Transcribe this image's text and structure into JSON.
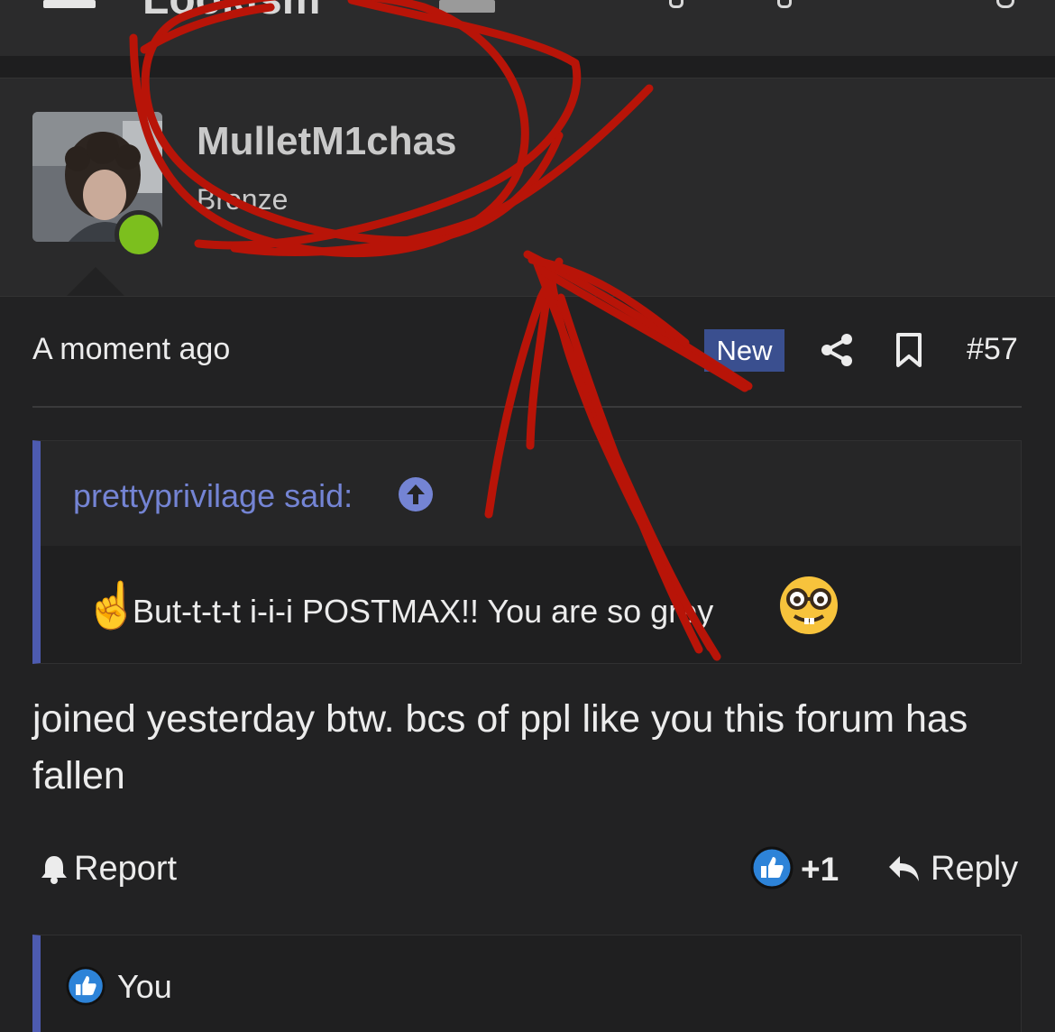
{
  "header": {
    "brand_partial": "Lookism",
    "menu_icon": "hamburger-icon"
  },
  "post": {
    "author": {
      "username": "MulletM1chas",
      "rank": "Bronze",
      "status": "online",
      "status_color": "#7cbf1e"
    },
    "meta": {
      "timestamp": "A moment ago",
      "badge": "New",
      "badge_color": "#3a4f8f",
      "share_icon": "share-icon",
      "bookmark_icon": "bookmark-icon",
      "post_number": "#57"
    },
    "quote": {
      "author_label": "prettyprivilage said:",
      "author_color": "#7484d4",
      "text": "But-t-t-t i-i-i POSTMAX!! You are so grey",
      "leading_emoji": "☝️",
      "trailing_emoji": "nerd-face"
    },
    "message": "joined yesterday btw. bcs of ppl like you this forum has fallen",
    "actions": {
      "report_label": "Report",
      "like_count": "+1",
      "reply_label": "Reply"
    },
    "reactions": {
      "label": "You",
      "icon": "like-icon"
    }
  },
  "annotation": {
    "type": "red freehand circle and arrow",
    "color": "#b81408"
  }
}
